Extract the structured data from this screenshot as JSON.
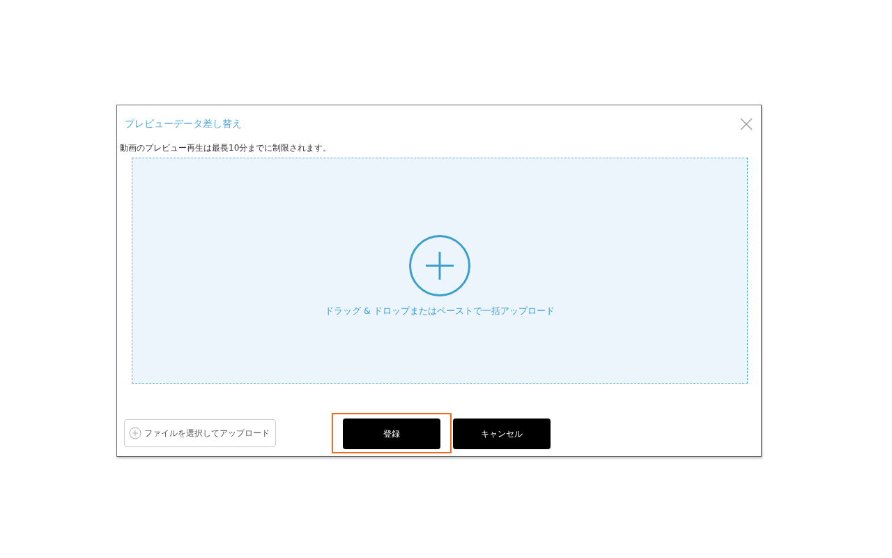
{
  "dialog": {
    "title": "プレビューデータ差し替え",
    "note": "動画のプレビュー再生は最長10分までに制限されます。",
    "dropzone": {
      "label": "ドラッグ & ドロップまたはペーストで一括アップロード"
    },
    "file_button": "ファイルを選択してアップロード",
    "buttons": [
      {
        "label": "登録",
        "highlighted": true
      },
      {
        "label": "キャンセル",
        "highlighted": false
      }
    ]
  }
}
